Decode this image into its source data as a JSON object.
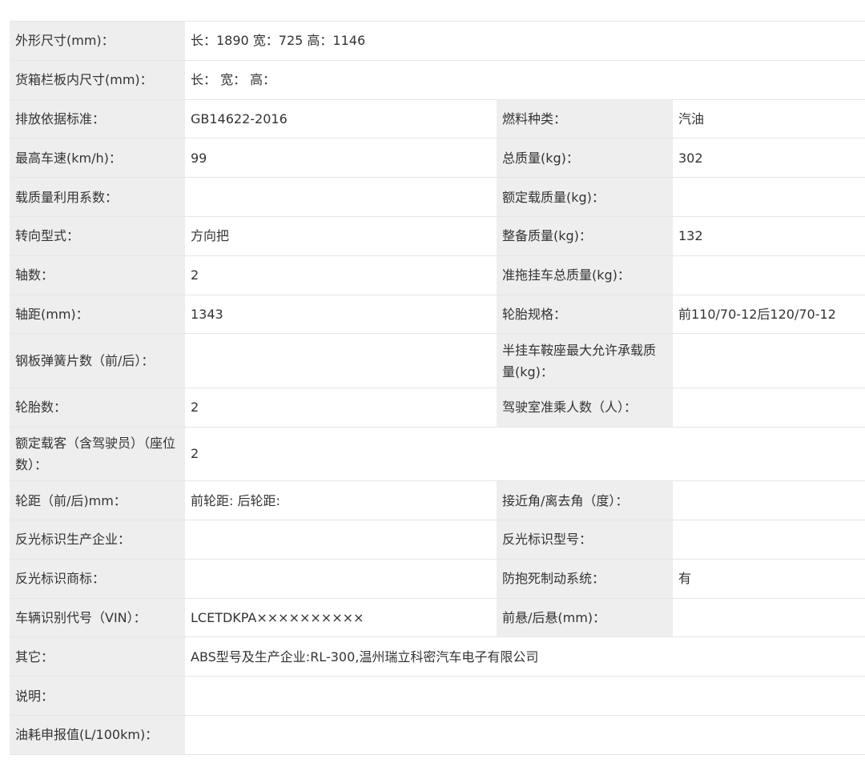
{
  "rows": [
    {
      "type": "full",
      "label": "外形尺寸(mm)：",
      "value": "长：1890 宽：725 高：1146"
    },
    {
      "type": "full",
      "label": "货箱栏板内尺寸(mm)：",
      "value": "长：  宽：  高："
    },
    {
      "type": "pair",
      "label1": "排放依据标准：",
      "value1": "GB14622-2016",
      "label2": "燃料种类：",
      "value2": "汽油"
    },
    {
      "type": "pair",
      "label1": "最高车速(km/h)：",
      "value1": "99",
      "label2": "总质量(kg)：",
      "value2": "302"
    },
    {
      "type": "pair",
      "label1": "载质量利用系数：",
      "value1": "",
      "label2": "额定载质量(kg)：",
      "value2": ""
    },
    {
      "type": "pair",
      "label1": "转向型式：",
      "value1": "方向把",
      "label2": "整备质量(kg)：",
      "value2": "132"
    },
    {
      "type": "pair",
      "label1": "轴数：",
      "value1": "2",
      "label2": "准拖挂车总质量(kg)：",
      "value2": ""
    },
    {
      "type": "pair",
      "label1": "轴距(mm)：",
      "value1": "1343",
      "label2": "轮胎规格：",
      "value2": "前110/70-12后120/70-12"
    },
    {
      "type": "pair",
      "label1": "钢板弹簧片数（前/后）：",
      "value1": "",
      "label2": "半挂车鞍座最大允许承载质量(kg)：",
      "value2": ""
    },
    {
      "type": "pair",
      "label1": "轮胎数：",
      "value1": "2",
      "label2": "驾驶室准乘人数（人）：",
      "value2": ""
    },
    {
      "type": "full",
      "label": "额定载客（含驾驶员）（座位数）：",
      "value": "2"
    },
    {
      "type": "pair",
      "label1": "轮距（前/后)mm：",
      "value1": "前轮距: 后轮距:",
      "label2": "接近角/离去角（度）：",
      "value2": ""
    },
    {
      "type": "pair",
      "label1": "反光标识生产企业：",
      "value1": "",
      "label2": "反光标识型号：",
      "value2": ""
    },
    {
      "type": "pair",
      "label1": "反光标识商标：",
      "value1": "",
      "label2": "防抱死制动系统：",
      "value2": "有"
    },
    {
      "type": "pair",
      "label1": "车辆识别代号（VIN）：",
      "value1": "LCETDKPA××××××××××",
      "label2": "前悬/后悬(mm)：",
      "value2": ""
    },
    {
      "type": "full",
      "label": "其它：",
      "value": "ABS型号及生产企业:RL-300,温州瑞立科密汽车电子有限公司"
    },
    {
      "type": "full",
      "label": "说明：",
      "value": ""
    },
    {
      "type": "full",
      "label": "油耗申报值(L/100km)：",
      "value": ""
    }
  ]
}
